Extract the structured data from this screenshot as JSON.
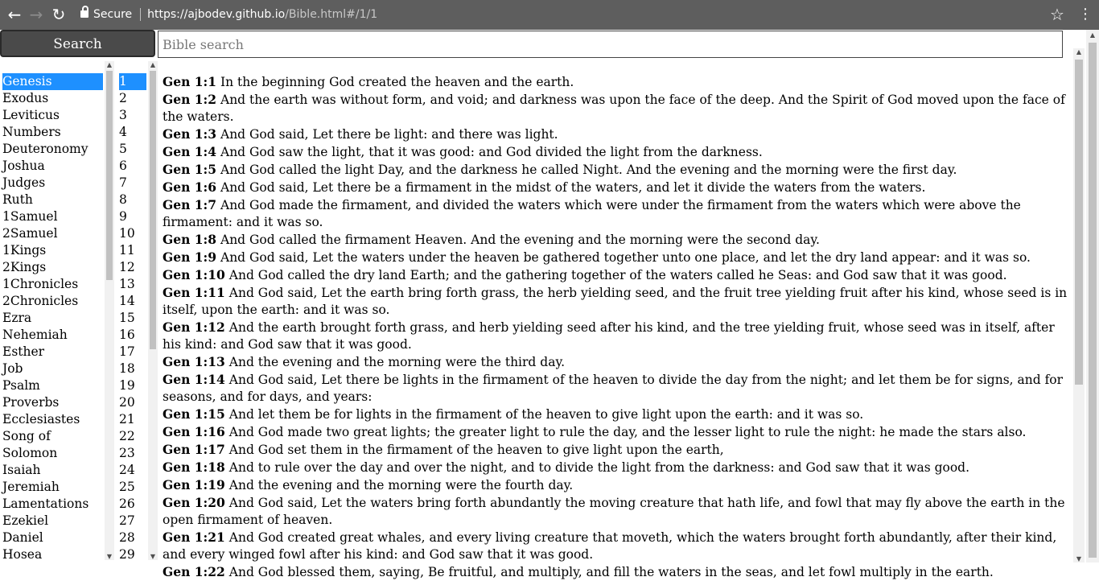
{
  "browser": {
    "back_icon": "arrow-left-icon",
    "forward_icon": "arrow-right-icon",
    "reload_icon": "reload-icon",
    "secure_label": "Secure",
    "url_host": "https://ajbodev.github.io",
    "url_path": "/Bible.html#/1/1",
    "bookmark_icon": "star-icon",
    "menu_icon": "kebab-icon"
  },
  "search": {
    "button_label": "Search",
    "placeholder": "Bible search",
    "value": ""
  },
  "books": [
    "Genesis",
    "Exodus",
    "Leviticus",
    "Numbers",
    "Deuteronomy",
    "Joshua",
    "Judges",
    "Ruth",
    "1Samuel",
    "2Samuel",
    "1Kings",
    "2Kings",
    "1Chronicles",
    "2Chronicles",
    "Ezra",
    "Nehemiah",
    "Esther",
    "Job",
    "Psalm",
    "Proverbs",
    "Ecclesiastes",
    "Song of",
    "Solomon",
    "Isaiah",
    "Jeremiah",
    "Lamentations",
    "Ezekiel",
    "Daniel",
    "Hosea"
  ],
  "selected_book": "Genesis",
  "chapters": [
    "1",
    "2",
    "3",
    "4",
    "5",
    "6",
    "7",
    "8",
    "9",
    "10",
    "11",
    "12",
    "13",
    "14",
    "15",
    "16",
    "17",
    "18",
    "19",
    "20",
    "21",
    "22",
    "23",
    "24",
    "25",
    "26",
    "27",
    "28",
    "29"
  ],
  "selected_chapter": "1",
  "colors": {
    "selection": "#1e90ff",
    "chrome": "#5e5e5e"
  },
  "verses": [
    {
      "ref": "Gen 1:1",
      "text": "In the beginning God created the heaven and the earth."
    },
    {
      "ref": "Gen 1:2",
      "text": "And the earth was without form, and void; and darkness was upon the face of the deep. And the Spirit of God moved upon the face of the waters."
    },
    {
      "ref": "Gen 1:3",
      "text": "And God said, Let there be light: and there was light."
    },
    {
      "ref": "Gen 1:4",
      "text": "And God saw the light, that it was good: and God divided the light from the darkness."
    },
    {
      "ref": "Gen 1:5",
      "text": "And God called the light Day, and the darkness he called Night. And the evening and the morning were the first day."
    },
    {
      "ref": "Gen 1:6",
      "text": "And God said, Let there be a firmament in the midst of the waters, and let it divide the waters from the waters."
    },
    {
      "ref": "Gen 1:7",
      "text": "And God made the firmament, and divided the waters which were under the firmament from the waters which were above the firmament: and it was so."
    },
    {
      "ref": "Gen 1:8",
      "text": "And God called the firmament Heaven. And the evening and the morning were the second day."
    },
    {
      "ref": "Gen 1:9",
      "text": "And God said, Let the waters under the heaven be gathered together unto one place, and let the dry land appear: and it was so."
    },
    {
      "ref": "Gen 1:10",
      "text": "And God called the dry land Earth; and the gathering together of the waters called he Seas: and God saw that it was good."
    },
    {
      "ref": "Gen 1:11",
      "text": "And God said, Let the earth bring forth grass, the herb yielding seed, and the fruit tree yielding fruit after his kind, whose seed is in itself, upon the earth: and it was so."
    },
    {
      "ref": "Gen 1:12",
      "text": "And the earth brought forth grass, and herb yielding seed after his kind, and the tree yielding fruit, whose seed was in itself, after his kind: and God saw that it was good."
    },
    {
      "ref": "Gen 1:13",
      "text": "And the evening and the morning were the third day."
    },
    {
      "ref": "Gen 1:14",
      "text": "And God said, Let there be lights in the firmament of the heaven to divide the day from the night; and let them be for signs, and for seasons, and for days, and years:"
    },
    {
      "ref": "Gen 1:15",
      "text": "And let them be for lights in the firmament of the heaven to give light upon the earth: and it was so."
    },
    {
      "ref": "Gen 1:16",
      "text": "And God made two great lights; the greater light to rule the day, and the lesser light to rule the night: he made the stars also."
    },
    {
      "ref": "Gen 1:17",
      "text": "And God set them in the firmament of the heaven to give light upon the earth,"
    },
    {
      "ref": "Gen 1:18",
      "text": "And to rule over the day and over the night, and to divide the light from the darkness: and God saw that it was good."
    },
    {
      "ref": "Gen 1:19",
      "text": "And the evening and the morning were the fourth day."
    },
    {
      "ref": "Gen 1:20",
      "text": "And God said, Let the waters bring forth abundantly the moving creature that hath life, and fowl that may fly above the earth in the open firmament of heaven."
    },
    {
      "ref": "Gen 1:21",
      "text": "And God created great whales, and every living creature that moveth, which the waters brought forth abundantly, after their kind, and every winged fowl after his kind: and God saw that it was good."
    },
    {
      "ref": "Gen 1:22",
      "text": "And God blessed them, saying, Be fruitful, and multiply, and fill the waters in the seas, and let fowl multiply in the earth."
    }
  ]
}
